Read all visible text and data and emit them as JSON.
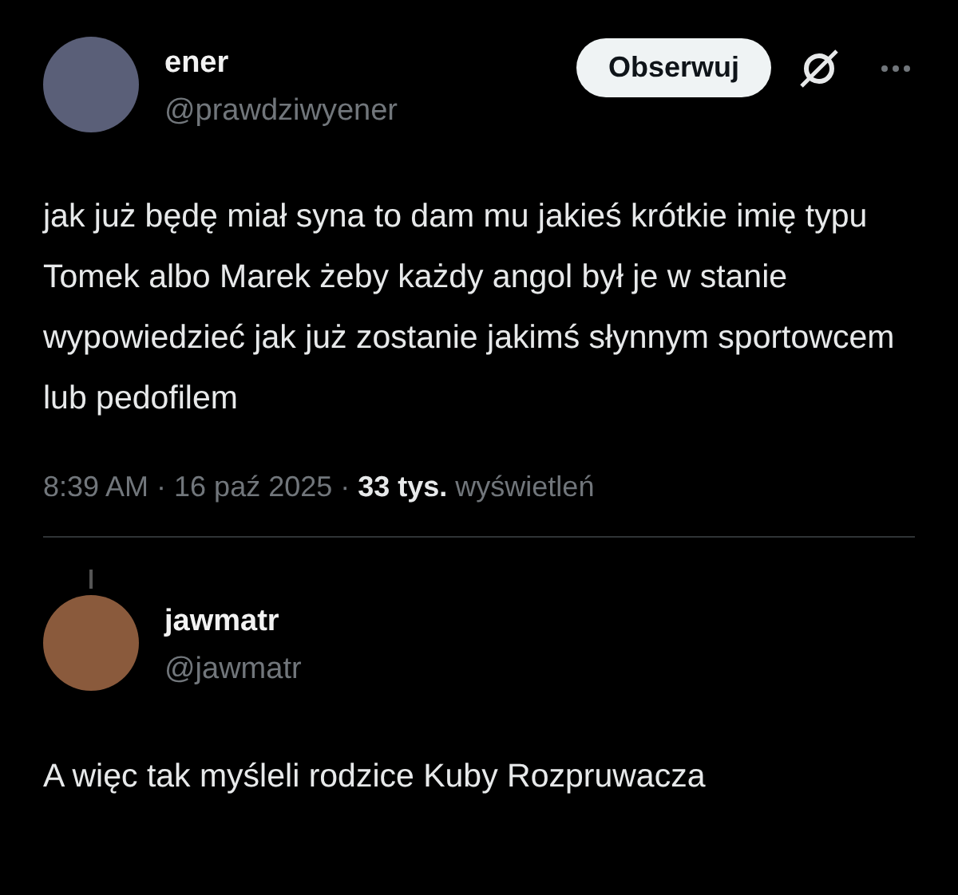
{
  "post": {
    "author": {
      "name": "ener",
      "handle": "@prawdziwyener"
    },
    "follow_button": "Obserwuj",
    "text": "jak już będę miał syna to dam mu jakieś krótkie imię typu Tomek albo Marek żeby każdy angol był je w stanie wypowiedzieć jak już zostanie jakimś słynnym sportowcem lub pedofilem",
    "meta": [
      {
        "kind": "plain",
        "text": "8:39 AM · 16 paź 2025 ·"
      },
      {
        "kind": "strong",
        "text": "33 tys."
      },
      {
        "kind": "plain",
        "text": "wyświetleń"
      }
    ]
  },
  "reply": {
    "author": {
      "name": "jawmatr",
      "handle": "@jawmatr"
    },
    "text": "A więc tak myśleli rodzice Kuby Rozpruwacza"
  }
}
